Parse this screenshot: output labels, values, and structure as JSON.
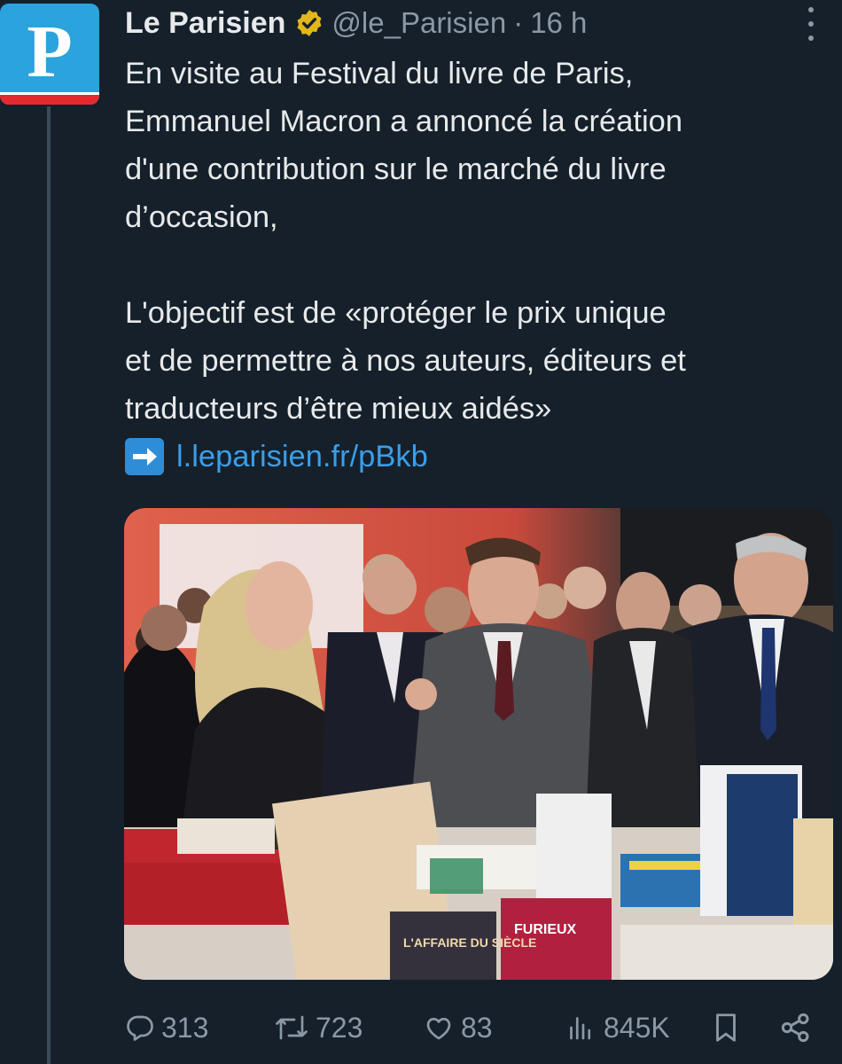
{
  "tweet": {
    "author": {
      "name": "Le Parisien",
      "handle": "@le_Parisien",
      "time": "16 h",
      "avatar_letter": "P",
      "avatar_color": "#2ba3dc",
      "verified_color": "#e2b719"
    },
    "lines": [
      "En visite au Festival du livre de Paris,",
      "Emmanuel Macron a annoncé la création",
      "d'une  contribution sur le marché du livre",
      "d’occasion,",
      "",
      "L'objectif est de «protéger le prix unique",
      "et de permettre à nos auteurs, éditeurs et",
      "traducteurs d’être mieux aidés»"
    ],
    "link_emoji": "➡️",
    "link_text": "l.leparisien.fr/pBkb",
    "link_color": "#3a9ee8",
    "media": {
      "kind": "photo",
      "book_titles": [
        "L'AFFAIRE DU SIÈCLE",
        "FURIEUX"
      ]
    },
    "actions": {
      "replies": "313",
      "reposts": "723",
      "likes": "83",
      "views": "845K"
    },
    "icons": [
      "verified-badge-icon",
      "more-icon",
      "reply-icon",
      "repost-icon",
      "like-icon",
      "views-icon",
      "bookmark-icon",
      "share-icon"
    ]
  }
}
